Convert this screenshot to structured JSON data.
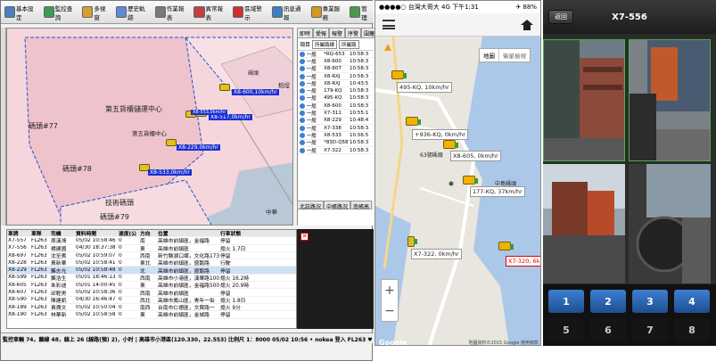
{
  "desktop": {
    "toolbar": [
      {
        "label": "基本設定",
        "color": "#4a7fc0"
      },
      {
        "label": "監控查詢",
        "color": "#3d9a58"
      },
      {
        "label": "多視窗",
        "color": "#d4a030"
      },
      {
        "label": "歷史軌跡",
        "color": "#5b8ad6"
      },
      {
        "label": "作業報表",
        "color": "#7a7a7a"
      },
      {
        "label": "異常報表",
        "color": "#c04040"
      },
      {
        "label": "區域警示",
        "color": "#d03030"
      },
      {
        "label": "訊息通報",
        "color": "#3d80c0"
      },
      {
        "label": "專業服務",
        "color": "#d09a20"
      },
      {
        "label": "管理",
        "color": "#4a9a4a"
      }
    ],
    "map_labels": {
      "center": "第五貨櫃儲運中心",
      "center2": "第五貨櫃中心",
      "pier77": "碼頭#77",
      "pier78": "碼頭#78",
      "pier79": "碼頭#79",
      "pier_b": "碼頭",
      "tech": "技術碼頭",
      "zhonghua": "中華",
      "jingpu": "稻埕"
    },
    "map_vehicles": [
      "X8-600,10km/hr",
      "X8-517,0km/hr",
      "X8-229,0km/hr",
      "X8-533,0km/hr",
      "X8-553,0km/hr"
    ],
    "right_tabs": [
      "即時",
      "愛報",
      "報警",
      "序警",
      "圍籬"
    ],
    "right_filter": {
      "label": "項目",
      "select": "所屬路線",
      "select2": "所屬路"
    },
    "right_rows": [
      [
        "一般",
        "*RQ-653",
        "10:58:3"
      ],
      [
        "一般",
        "X8-600",
        "10:58:3"
      ],
      [
        "一般",
        "X8-607",
        "10:58:3"
      ],
      [
        "一般",
        "X8-RXJ",
        "10:58:3"
      ],
      [
        "一般",
        "X8-RXJ",
        "10:43:5"
      ],
      [
        "一般",
        "179-KQ",
        "10:58:3"
      ],
      [
        "一般",
        "495-KQ",
        "10:58:3"
      ],
      [
        "一般",
        "X8-600",
        "10:58:3"
      ],
      [
        "一般",
        "X7-311",
        "10:55:1"
      ],
      [
        "一般",
        "X8-229",
        "10:48:4"
      ],
      [
        "一般",
        "X7-338",
        "10:58:3"
      ],
      [
        "一般",
        "X8-533",
        "10:56:5"
      ],
      [
        "一般",
        "*83D-Q58",
        "10:58:3"
      ],
      [
        "一般",
        "X7-322",
        "10:58:3"
      ]
    ],
    "right_bottom_tabs": [
      "北誌路況",
      "中帳路況",
      "南帳高"
    ],
    "table_headers": [
      "車牌",
      "車隊",
      "司機",
      "資料時間",
      "速度(公",
      "方向",
      "位置",
      "行車狀態"
    ],
    "table_rows": [
      [
        "X7-557",
        "FL263",
        "周漢鴻",
        "05/02 10:58:46",
        "0",
        "南",
        "高雄市前鎮區，金福路",
        "停留"
      ],
      [
        "X7-556",
        "FL263",
        "楊建國",
        "04/30 18:37:38",
        "0",
        "東",
        "高雄市前鎮區",
        "熄火 1.7日"
      ],
      [
        "X8-697",
        "FL263",
        "沈至賓",
        "05/02 10:59:07",
        "0",
        "西南",
        "新竹縣湖口鄉，文化路173",
        "停留"
      ],
      [
        "X8-228",
        "FL263",
        "黃新華",
        "05/02 10:58:41",
        "0",
        "東北",
        "高雄市前鎮區，盛龍路",
        "行駛"
      ],
      [
        "X8-229",
        "FL263",
        "龔志光",
        "05/02 10:58:48",
        "0",
        "北",
        "高雄市前鎮區，盛龍路",
        "停留"
      ],
      [
        "X8-599",
        "FL263",
        "龔浩生",
        "05/01 18:46:13",
        "0",
        "西南",
        "高雄市小港區，漢華路100",
        "熄火 16.2時"
      ],
      [
        "X8-605",
        "FL263",
        "朱彩迪",
        "05/01 14:00:45",
        "0",
        "東",
        "高雄市前鎮區，金福路500",
        "熄火 20.9時"
      ],
      [
        "X8-607",
        "FL263",
        "邱輕男",
        "05/02 10:58:36",
        "0",
        "西南",
        "高雄市前鎮區",
        "停留"
      ],
      [
        "X8-590",
        "FL263",
        "陳建凱",
        "04/30 16:46:47",
        "0",
        "西北",
        "高雄市鳳山區，青年一街",
        "熄火 1.8日"
      ],
      [
        "X8-189",
        "FL263",
        "黃潤文",
        "05/02 10:50:04",
        "0",
        "南西",
        "台南市仁德區，文賢路一",
        "熄火 9分"
      ],
      [
        "X8-190",
        "FL263",
        "林華新",
        "05/02 10:58:58",
        "0",
        "東",
        "高雄市前鎮區，金城路",
        "停留"
      ]
    ],
    "statusbar": "監控車輛 74，離線 48，線上 26 (線路(預) 2)，小时 | 高雄市小港區(120.330，22.553) 比例尺 1：8000 05/02 10:56 • nokea 登入 FL263 ♥ 系統版本 10"
  },
  "phone": {
    "status_left": "●●●●○ 台灣大哥大 4G 下午1:31",
    "status_right": "✈ 88%",
    "map_type": [
      "地圖",
      "衛星檢視"
    ],
    "vehicles": [
      {
        "label": "495-KQ, 10km/hr",
        "hl": false
      },
      {
        "label": "+936-KQ, 0km/hr",
        "hl": false
      },
      {
        "label": "X8-605, 0km/hr",
        "hl": false
      },
      {
        "label": "177-KQ, 37km/hr",
        "hl": false
      },
      {
        "label": "X7-322, 0km/hr",
        "hl": false
      },
      {
        "label": "X7-320, 6km",
        "hl": true
      }
    ],
    "place1": "63號碼頭",
    "place2": "中島碼頭",
    "zoom_in": "+",
    "zoom_out": "−",
    "footer_left": "Google",
    "footer_right": "地圖資料©2015 Google  使用條款"
  },
  "camera": {
    "back": "返回",
    "title": "X7-556",
    "buttons": [
      "1",
      "2",
      "3",
      "4",
      "5",
      "6",
      "7",
      "8"
    ]
  }
}
